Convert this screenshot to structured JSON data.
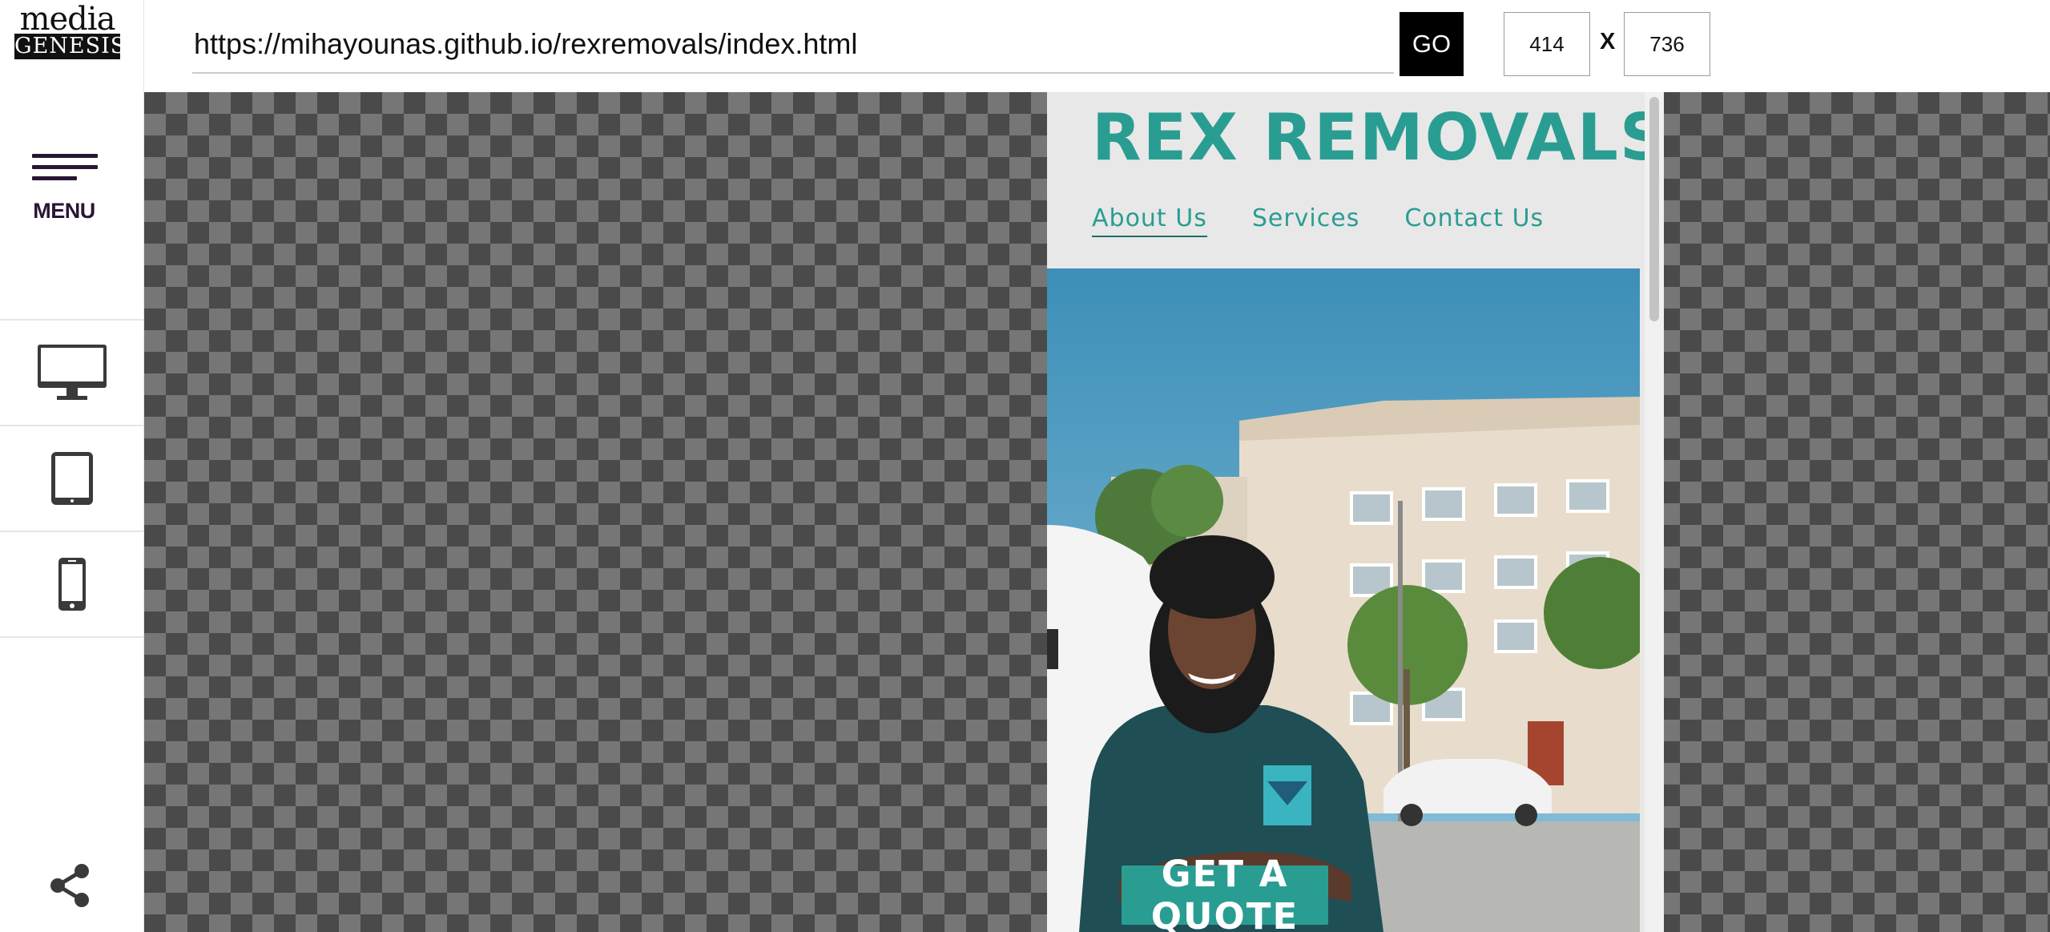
{
  "brand": {
    "line1": "media",
    "line2": "GENESIS"
  },
  "sidebar": {
    "menu_label": "MENU",
    "devices": [
      {
        "name": "desktop",
        "icon": "desktop-monitor-icon"
      },
      {
        "name": "tablet",
        "icon": "tablet-icon"
      },
      {
        "name": "phone",
        "icon": "mobile-phone-icon"
      }
    ],
    "share_icon": "share-icon"
  },
  "toolbar": {
    "url": "https://mihayounas.github.io/rexremovals/index.html",
    "go_label": "GO",
    "width_value": "414",
    "height_value": "736",
    "separator": "X"
  },
  "site": {
    "title": "REX REMOVALS",
    "nav": [
      "About Us",
      "Services",
      "Contact Us"
    ],
    "active_nav": "About Us",
    "cta_label": "GET A QUOTE"
  },
  "colors": {
    "accent": "#2a9d92",
    "menu_icon": "#2a1535",
    "checker_dark": "#4a4a4a",
    "checker_light": "#767676",
    "page_bg": "#e8e8e8",
    "go_button": "#000000"
  }
}
